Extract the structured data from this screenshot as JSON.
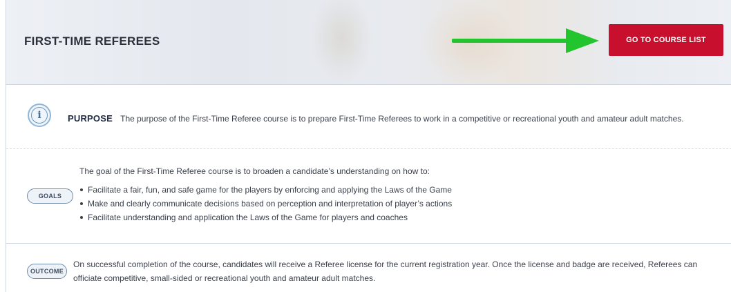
{
  "header": {
    "title": "FIRST-TIME REFEREES",
    "course_list_button": "GO TO COURSE LIST",
    "arrow_color": "#22c52e",
    "button_color": "#c8102e"
  },
  "purpose": {
    "icon": "info-icon",
    "label": "PURPOSE",
    "text": "The purpose of the First-Time Referee course is to prepare First-Time Referees to work in a competitive or recreational youth and amateur adult matches."
  },
  "goals": {
    "label": "GOALS",
    "intro": "The goal of the First-Time Referee course is to broaden a candidate’s understanding on how to:",
    "items": [
      "Facilitate a fair, fun, and safe game for the players by enforcing and applying the Laws of the Game",
      "Make and clearly communicate decisions based on perception and interpretation of player’s actions",
      "Facilitate understanding and application the Laws of the Game for players and coaches"
    ]
  },
  "outcome": {
    "label": "OUTCOME",
    "text": "On successful completion of the course, candidates will receive a Referee license for the current registration year. Once the license and badge are received, Referees can officiate competitive, small-sided or recreational youth and amateur adult matches."
  }
}
